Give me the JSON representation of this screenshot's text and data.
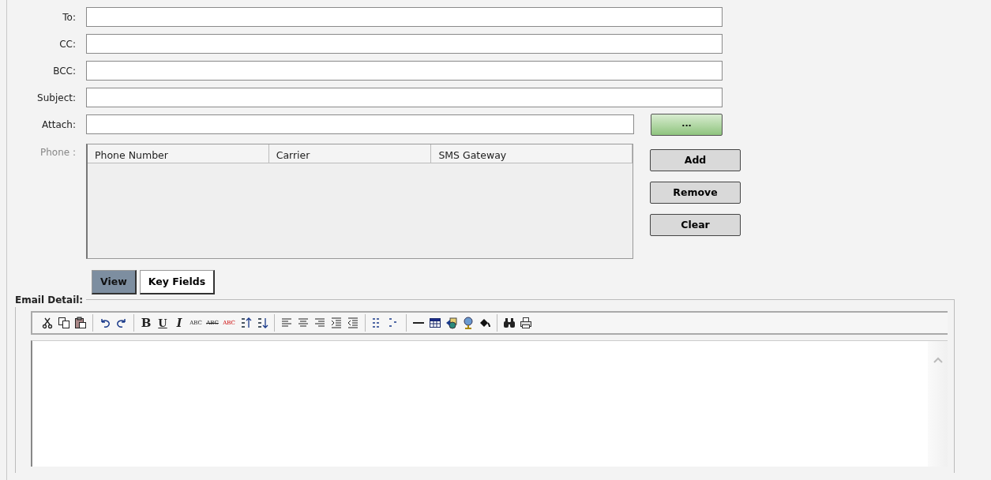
{
  "fields": [
    {
      "label": "To:",
      "kind": "text"
    },
    {
      "label": "CC:",
      "kind": "text"
    },
    {
      "label": "BCC:",
      "kind": "text"
    },
    {
      "label": "Subject:",
      "kind": "text"
    },
    {
      "label": "Attach:",
      "kind": "file",
      "button": "..."
    }
  ],
  "phone": {
    "label": "Phone :",
    "disabled": true,
    "columns": [
      "Phone Number",
      "Carrier",
      "SMS Gateway"
    ],
    "buttons": [
      "Add",
      "Remove",
      "Clear"
    ]
  },
  "tabs": [
    {
      "label": "View",
      "selected": true
    },
    {
      "label": "Key Fields",
      "selected": false
    }
  ],
  "email_detail": {
    "legend": "Email Detail:",
    "toolbar_groups": [
      [
        {
          "kind": "icon"
        },
        {
          "kind": "icon"
        },
        {
          "kind": "icon"
        }
      ],
      [
        {
          "kind": "icon"
        },
        {
          "kind": "icon"
        }
      ],
      [
        {
          "kind": "bold",
          "label": "B"
        },
        {
          "kind": "underline",
          "label": "U"
        },
        {
          "kind": "italic",
          "label": "I"
        },
        {
          "kind": "small",
          "label": "ABC"
        },
        {
          "kind": "strike",
          "label": "ABC"
        },
        {
          "kind": "spell",
          "label": "ABC"
        },
        {
          "kind": "icon"
        },
        {
          "kind": "icon"
        }
      ],
      [
        {
          "kind": "icon"
        },
        {
          "kind": "icon"
        },
        {
          "kind": "icon"
        },
        {
          "kind": "icon"
        },
        {
          "kind": "icon"
        }
      ],
      [
        {
          "kind": "icon"
        },
        {
          "kind": "icon"
        }
      ],
      [
        {
          "kind": "icon"
        },
        {
          "kind": "icon"
        },
        {
          "kind": "icon"
        },
        {
          "kind": "icon"
        },
        {
          "kind": "icon"
        }
      ],
      [
        {
          "kind": "icon"
        },
        {
          "kind": "icon"
        }
      ]
    ]
  }
}
